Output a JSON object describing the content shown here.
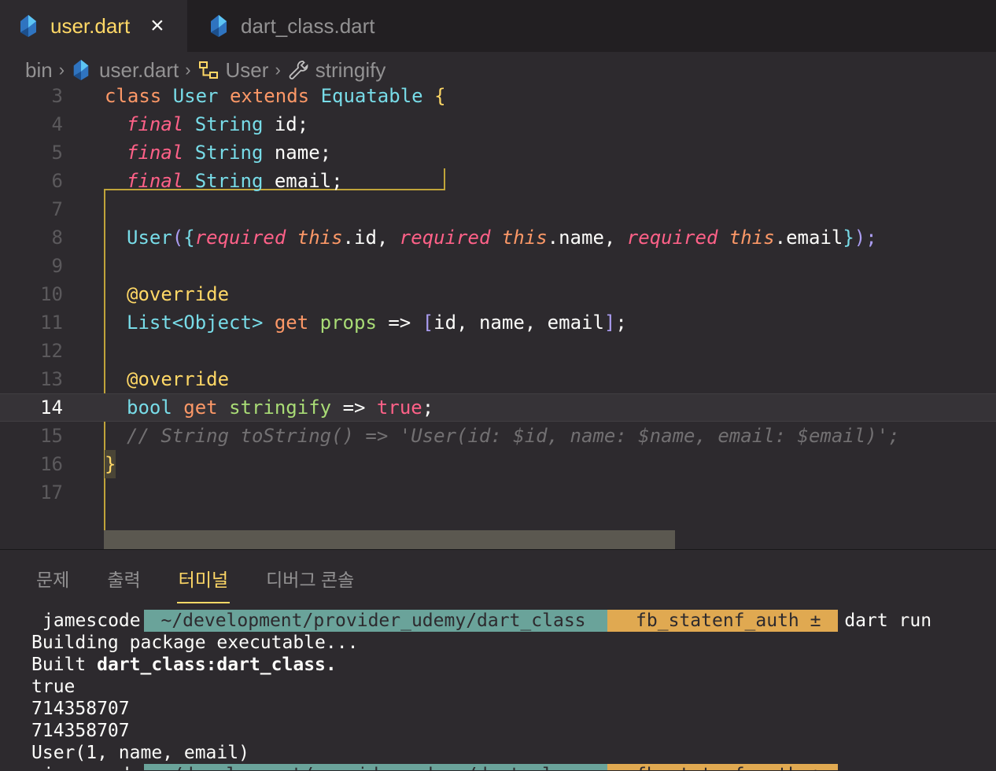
{
  "tabs": [
    {
      "label": "user.dart",
      "active": true,
      "close": "×"
    },
    {
      "label": "dart_class.dart",
      "active": false
    }
  ],
  "breadcrumb": {
    "parts": [
      "bin",
      "user.dart",
      "User",
      "stringify"
    ],
    "separator": "›"
  },
  "editor": {
    "line_numbers": [
      "3",
      "4",
      "5",
      "6",
      "7",
      "8",
      "9",
      "10",
      "11",
      "12",
      "13",
      "14",
      "15",
      "16",
      "17"
    ],
    "current_line": "14"
  },
  "code_tokens": {
    "l3": [
      "class",
      "User",
      "extends",
      "Equatable",
      "{"
    ],
    "l4": [
      "final",
      "String",
      "id;"
    ],
    "l5": [
      "final",
      "String",
      "name;"
    ],
    "l6": [
      "final",
      "String",
      "email;"
    ],
    "l8": [
      "User",
      "(",
      "{",
      "required",
      "this",
      ".id, ",
      "required",
      "this",
      ".name, ",
      "required",
      "this",
      ".email",
      "}",
      ");"
    ],
    "l10": [
      "@override"
    ],
    "l11": [
      "List",
      "<Object>",
      "get",
      "props",
      "=>",
      "[",
      "id, name, email",
      "]",
      ";"
    ],
    "l13": [
      "@override"
    ],
    "l14": [
      "bool",
      "get",
      "stringify",
      "=>",
      "true",
      ";"
    ],
    "l15": [
      "// String toString() => 'User(id: $id, name: $name, email: $email)';"
    ],
    "l16": [
      "}"
    ]
  },
  "panel": {
    "tabs": [
      "문제",
      "출력",
      "터미널",
      "디버그 콘솔"
    ],
    "active_tab": "터미널"
  },
  "terminal": {
    "prompt_user": "jamescode",
    "prompt_path": " ~/development/provider_udemy/dart_class ",
    "prompt_git": "  fb_statenf_auth ± ",
    "prompt_cmd": "dart run",
    "lines": [
      "Building package executable...",
      "Built ",
      "dart_class:dart_class.",
      "true",
      "714358707",
      "714358707",
      "User(1, name, email)"
    ]
  },
  "colors": {
    "background": "#2d2a2e",
    "accent": "#ffd866",
    "keyword": "#ff6188",
    "type": "#78dce8",
    "function": "#a9dc76",
    "comment": "#727072"
  }
}
